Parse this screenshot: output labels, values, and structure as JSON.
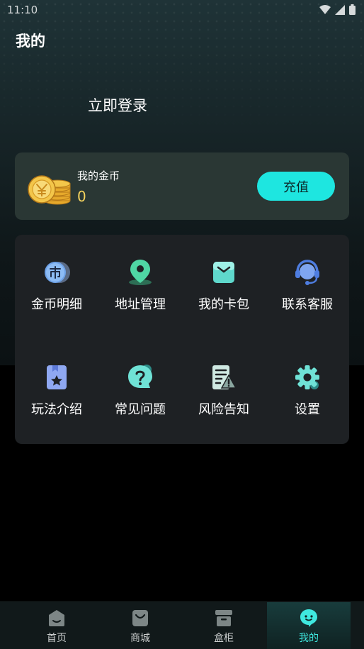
{
  "status": {
    "time": "11:10"
  },
  "header": {
    "title": "我的",
    "login_text": "立即登录"
  },
  "coins": {
    "label": "我的金币",
    "value": "0",
    "recharge_label": "充值",
    "colors": {
      "value": "#f4d35e",
      "button": "#1ee6e0"
    }
  },
  "menu": {
    "items": [
      {
        "label": "金币明细",
        "icon": "coin-detail-icon"
      },
      {
        "label": "地址管理",
        "icon": "location-pin-icon"
      },
      {
        "label": "我的卡包",
        "icon": "wallet-icon"
      },
      {
        "label": "联系客服",
        "icon": "headset-icon"
      },
      {
        "label": "玩法介绍",
        "icon": "star-bookmark-icon"
      },
      {
        "label": "常见问题",
        "icon": "question-bubble-icon"
      },
      {
        "label": "风险告知",
        "icon": "warning-document-icon"
      },
      {
        "label": "设置",
        "icon": "gear-icon"
      }
    ]
  },
  "tabbar": {
    "tabs": [
      {
        "label": "首页",
        "icon": "home-icon"
      },
      {
        "label": "商城",
        "icon": "shopping-bag-icon"
      },
      {
        "label": "盒柜",
        "icon": "cabinet-box-icon"
      },
      {
        "label": "我的",
        "icon": "profile-face-icon",
        "active": true
      }
    ],
    "active_color": "#3fe8df"
  }
}
